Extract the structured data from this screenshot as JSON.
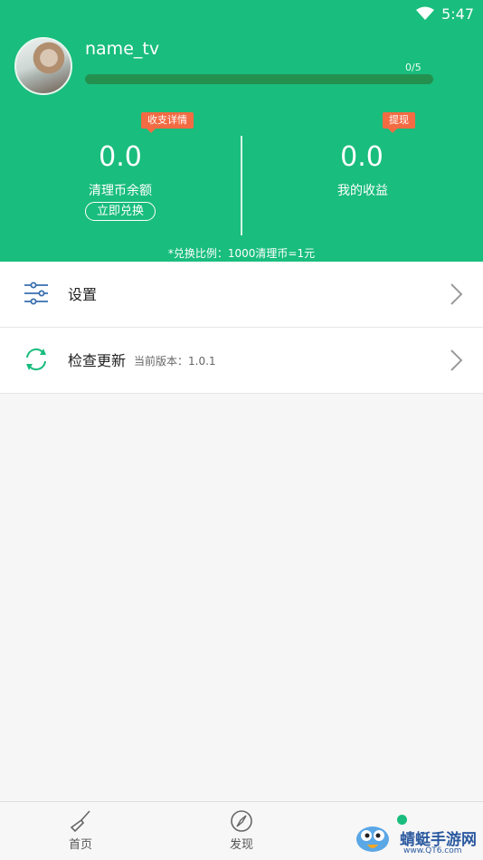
{
  "status": {
    "time": "5:47"
  },
  "profile": {
    "username": "name_tv",
    "progress_text": "0/5",
    "progress_fraction": 0
  },
  "balance": {
    "coins_tag": "收支详情",
    "coins_value": "0.0",
    "coins_caption": "清理币余额",
    "redeem_label": "立即兑换",
    "income_tag": "提现",
    "income_value": "0.0",
    "income_caption": "我的收益",
    "ratio_text": "*兑换比例：1000清理币=1元"
  },
  "menu": {
    "settings_label": "设置",
    "update_label": "检查更新",
    "update_version": "当前版本：1.0.1"
  },
  "nav": {
    "home_label": "首页",
    "discover_label": "发现"
  },
  "watermark": {
    "text": "蜻蜓手游网",
    "url": "www.QT6.com"
  },
  "colors": {
    "accent": "#19bd7d",
    "tag": "#f26b43"
  }
}
